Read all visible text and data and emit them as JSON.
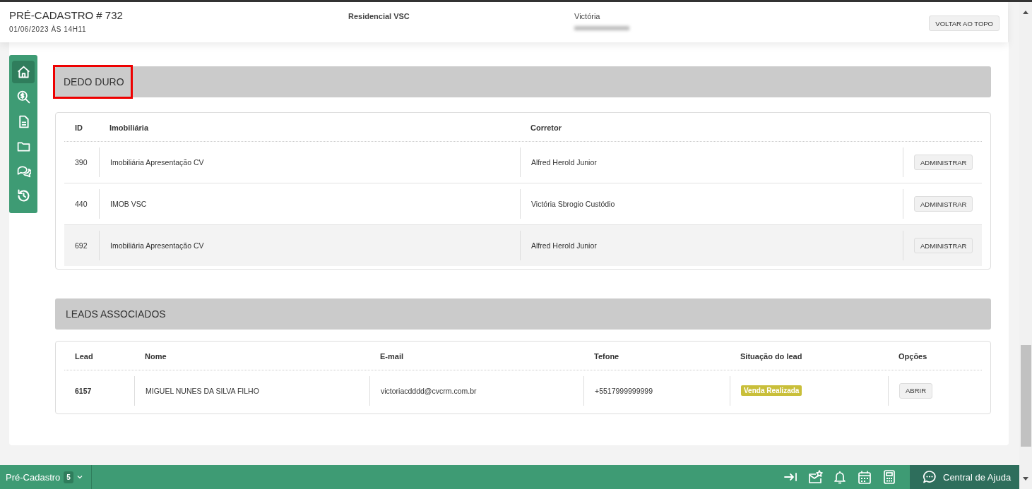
{
  "header": {
    "title": "PRÉ-CADASTRO # 732",
    "datetime": "01/06/2023 ÀS 14H11",
    "enterprise": "Residencial VSC",
    "user": "Victória",
    "back_to_top": "VOLTAR AO TOPO"
  },
  "sidebar": {
    "items": [
      {
        "kind": "home",
        "selected": true
      },
      {
        "kind": "money-search",
        "selected": false
      },
      {
        "kind": "document",
        "selected": false
      },
      {
        "kind": "folder",
        "selected": false
      },
      {
        "kind": "chat",
        "selected": false
      },
      {
        "kind": "history",
        "selected": false
      }
    ]
  },
  "dedo_duro": {
    "title": "DEDO DURO",
    "highlighted": true,
    "columns": [
      "ID",
      "Imobiliária",
      "Corretor"
    ],
    "rows": [
      {
        "id": "390",
        "agency": "Imobiliária Apresentação CV",
        "broker": "Alfred Herold Junior",
        "action": "ADMINISTRAR",
        "selected": false
      },
      {
        "id": "440",
        "agency": "IMOB VSC",
        "broker": "Victória Sbrogio Custódio",
        "action": "ADMINISTRAR",
        "selected": false
      },
      {
        "id": "692",
        "agency": "Imobiliária Apresentação CV",
        "broker": "Alfred Herold Junior",
        "action": "ADMINISTRAR",
        "selected": true
      }
    ]
  },
  "leads": {
    "title": "LEADS ASSOCIADOS",
    "highlighted": false,
    "columns": [
      "Lead",
      "Nome",
      "E-mail",
      "Tefone",
      "Situação do lead",
      "Opções"
    ],
    "rows": [
      {
        "lead": "6157",
        "name": "MIGUEL NUNES DA SILVA FILHO",
        "email": "victoriacdddd@cvcrm.com.br",
        "phone": "+5517999999999",
        "status": {
          "text": "Venda Realizada",
          "color": "#c9bf3a"
        },
        "action": "ABRIR"
      }
    ]
  },
  "footer": {
    "module": "Pré-Cadastro",
    "count": "5",
    "help": "Central de Ajuda"
  }
}
